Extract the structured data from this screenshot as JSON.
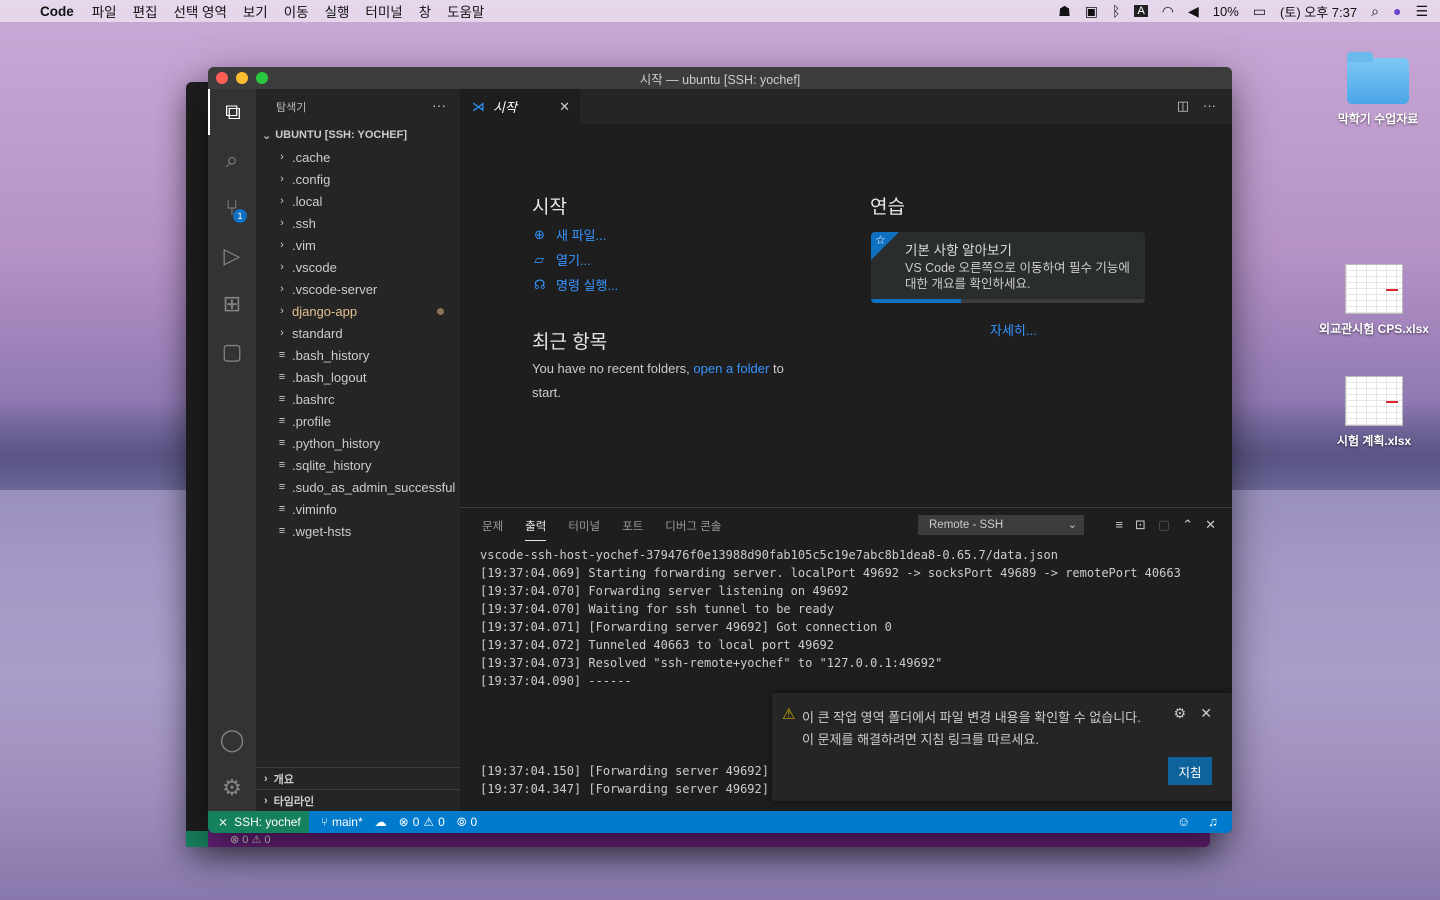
{
  "menubar": {
    "app": "Code",
    "items": [
      "파일",
      "편집",
      "선택 영역",
      "보기",
      "이동",
      "실행",
      "터미널",
      "창",
      "도움말"
    ],
    "battery": "10%",
    "clock": "(토) 오후 7:37",
    "input_source": "A"
  },
  "desktop": {
    "items": [
      {
        "label": "막학기 수업자료",
        "icon": "folder-icon"
      },
      {
        "label": "외교관시험 CPS.xlsx",
        "icon": "xlsx-file-icon"
      },
      {
        "label": "시험 계획.xlsx",
        "icon": "xlsx-file-icon"
      }
    ]
  },
  "back_window": {
    "status": "⊗ 0 ⚠ 0"
  },
  "window": {
    "title": "시작 — ubuntu [SSH: yochef]",
    "activity": {
      "scm_badge": "1"
    },
    "explorer": {
      "header": "탐색기",
      "root": "UBUNTU [SSH: YOCHEF]",
      "items": [
        {
          "name": ".cache",
          "type": "folder"
        },
        {
          "name": ".config",
          "type": "folder"
        },
        {
          "name": ".local",
          "type": "folder"
        },
        {
          "name": ".ssh",
          "type": "folder"
        },
        {
          "name": ".vim",
          "type": "folder"
        },
        {
          "name": ".vscode",
          "type": "folder"
        },
        {
          "name": ".vscode-server",
          "type": "folder"
        },
        {
          "name": "django-app",
          "type": "folder",
          "modified": true
        },
        {
          "name": "standard",
          "type": "folder"
        },
        {
          "name": ".bash_history",
          "type": "file"
        },
        {
          "name": ".bash_logout",
          "type": "file"
        },
        {
          "name": ".bashrc",
          "type": "file"
        },
        {
          "name": ".profile",
          "type": "file"
        },
        {
          "name": ".python_history",
          "type": "file"
        },
        {
          "name": ".sqlite_history",
          "type": "file"
        },
        {
          "name": ".sudo_as_admin_successful",
          "type": "file"
        },
        {
          "name": ".viminfo",
          "type": "file"
        },
        {
          "name": ".wget-hsts",
          "type": "file"
        }
      ],
      "outline": "개요",
      "timeline": "타임라인"
    },
    "tab": {
      "label": "시작"
    },
    "welcome": {
      "start_heading": "시작",
      "new_file": "새 파일...",
      "open": "열기...",
      "run_command": "명령 실행...",
      "recent_heading": "최근 항목",
      "recent_text_1": "You have no recent folders,",
      "recent_link": "open a folder",
      "recent_text_2": "to",
      "recent_text_3": "start.",
      "walk_heading": "연습",
      "walk_title": "기본 사항 알아보기",
      "walk_desc": "VS Code 오른쪽으로 이동하여 필수 기능에 대한 개요를 확인하세요.",
      "walk_progress": 0.33,
      "more": "자세히..."
    },
    "panel": {
      "tabs": [
        "문제",
        "출력",
        "터미널",
        "포트",
        "디버그 콘솔"
      ],
      "active_tab": "출력",
      "channel": "Remote - SSH",
      "lines": [
        "vscode-ssh-host-yochef-379476f0e13988d90fab105c5c19e7abc8b1dea8-0.65.7/data.json",
        "[19:37:04.069] Starting forwarding server. localPort 49692 -> socksPort 49689 -> remotePort 40663",
        "[19:37:04.070] Forwarding server listening on 49692",
        "[19:37:04.070] Waiting for ssh tunnel to be ready",
        "[19:37:04.071] [Forwarding server 49692] Got connection 0",
        "[19:37:04.072] Tunneled 40663 to local port 49692",
        "[19:37:04.073] Resolved \"ssh-remote+yochef\" to \"127.0.0.1:49692\"",
        "[19:37:04.090] ------",
        "",
        "",
        "",
        "",
        "[19:37:04.150] [Forwarding server 49692]",
        "[19:37:04.347] [Forwarding server 49692]"
      ]
    },
    "notification": {
      "line1": "이 큰 작업 영역 폴더에서 파일 변경 내용을 확인할 수 없습니다.",
      "line2": "이 문제를 해결하려면 지침 링크를 따르세요.",
      "button": "지침"
    },
    "status": {
      "remote": "SSH: yochef",
      "branch": "main*",
      "errors": "0",
      "warnings": "0",
      "ports": "0"
    }
  }
}
